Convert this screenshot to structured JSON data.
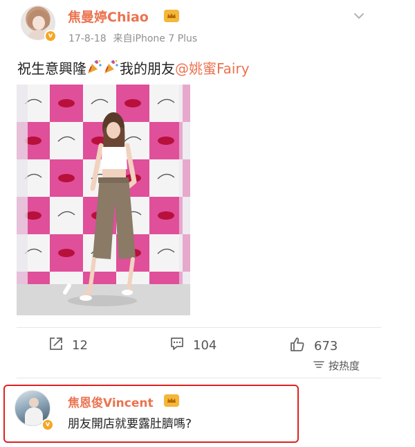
{
  "post": {
    "author": "焦曼婷Chiao",
    "date": "17-8-18",
    "source": "来自iPhone 7 Plus",
    "text_before": "祝生意興隆",
    "text_middle": "我的朋友",
    "mention": "@姚蜜Fairy"
  },
  "actions": {
    "shares": "12",
    "comments": "104",
    "likes": "673",
    "sort_label": "按热度"
  },
  "comment": {
    "author": "焦恩俊Vincent",
    "text": "朋友開店就要露肚臍嗎?"
  },
  "colors": {
    "accent": "#eb7350",
    "highlight_border": "#e02020",
    "verified": "#f5a623"
  },
  "icons": {
    "share": "share-icon",
    "comment": "comment-icon",
    "like": "thumbs-up-icon",
    "sort": "sort-icon",
    "dropdown": "chevron-down-icon",
    "party": "party-popper-icon",
    "verified": "verified-badge-icon",
    "crown": "crown-badge-icon"
  }
}
